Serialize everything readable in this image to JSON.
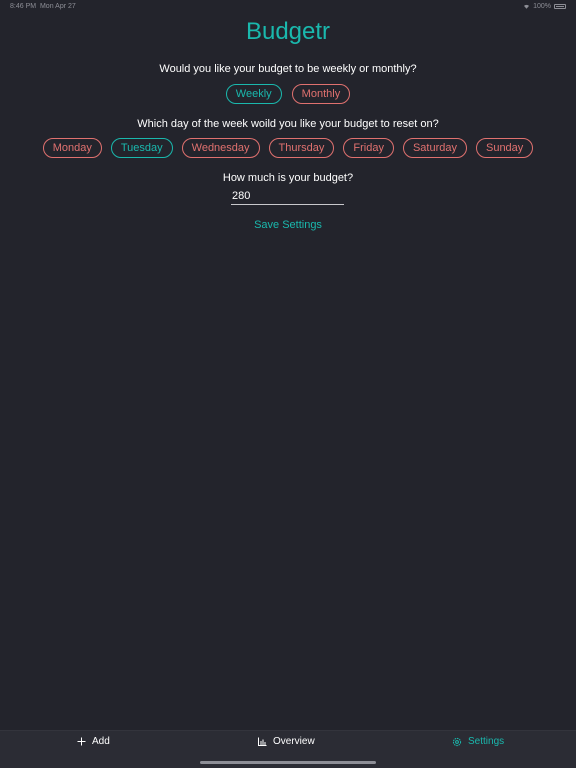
{
  "status_bar": {
    "time": "8:46 PM",
    "date": "Mon Apr 27",
    "battery": "100%"
  },
  "app": {
    "title": "Budgetr"
  },
  "period": {
    "question": "Would you like your budget to be weekly or monthly?",
    "options": [
      "Weekly",
      "Monthly"
    ],
    "selected": "Weekly"
  },
  "reset_day": {
    "question": "Which day of the week woild you like your budget to reset on?",
    "options": [
      "Monday",
      "Tuesday",
      "Wednesday",
      "Thursday",
      "Friday",
      "Saturday",
      "Sunday"
    ],
    "selected": "Tuesday"
  },
  "budget": {
    "question": "How much is your budget?",
    "value": "280"
  },
  "save": {
    "label": "Save Settings"
  },
  "tabs": [
    {
      "label": "Add",
      "icon": "plus-icon"
    },
    {
      "label": "Overview",
      "icon": "bar-chart-icon"
    },
    {
      "label": "Settings",
      "icon": "gear-icon"
    }
  ],
  "active_tab": "Settings",
  "colors": {
    "background": "#23242c",
    "accent": "#1ab8ad",
    "unselected": "#e0716f",
    "tab_bar": "#2b2c34"
  }
}
